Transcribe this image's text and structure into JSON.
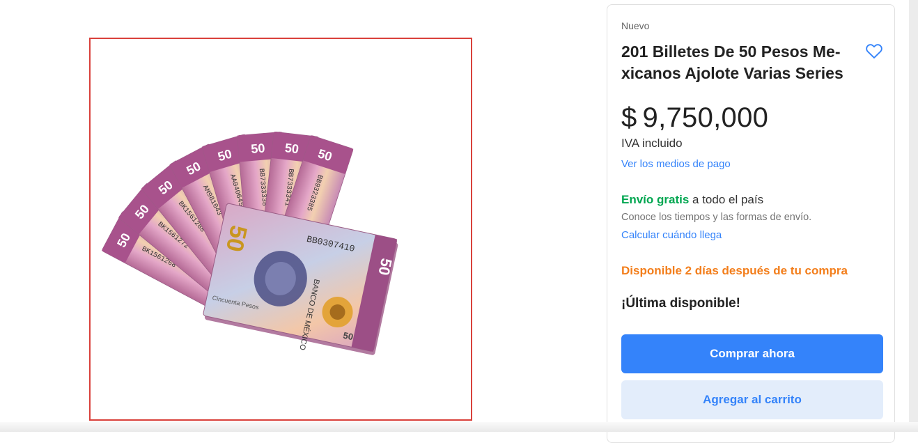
{
  "product": {
    "image_alt": "Abanico de billetes de 50 pesos mexicanos",
    "banknote": {
      "denomination": "50",
      "serial_front": "BB0307410",
      "bank_name": "BANCO DE MÉXICO",
      "serials_fan": [
        "BK1561268",
        "BK1561272",
        "BK1561288",
        "AM981043",
        "AA0406452",
        "BB7333338",
        "BB7333341",
        "BB9323385"
      ],
      "caption": "Cincuenta Pesos"
    }
  },
  "buybox": {
    "condition": "Nuevo",
    "title": "201 Billetes De 50 Pesos Me- xicanos Ajolote Varias Series",
    "currency": "$",
    "price": "9,750,000",
    "tax_note": "IVA incluido",
    "payment_link": "Ver los medios de pago",
    "shipping_free": "Envío gratis",
    "shipping_rest": " a todo el país",
    "shipping_sub": "Conoce los tiempos y las formas de envío.",
    "shipping_calc": "Calcular cuándo llega",
    "availability": "Disponible 2 días después de tu compra",
    "stock_note": "¡Última disponible!",
    "buy_now": "Comprar ahora",
    "add_cart": "Agregar al carrito",
    "favorite_icon": "heart-outline-icon"
  },
  "colors": {
    "accent": "#3483fa",
    "accent_light": "#e3edfb",
    "green": "#00a650",
    "orange": "#f37e1b",
    "frame_red": "#d9413b"
  }
}
